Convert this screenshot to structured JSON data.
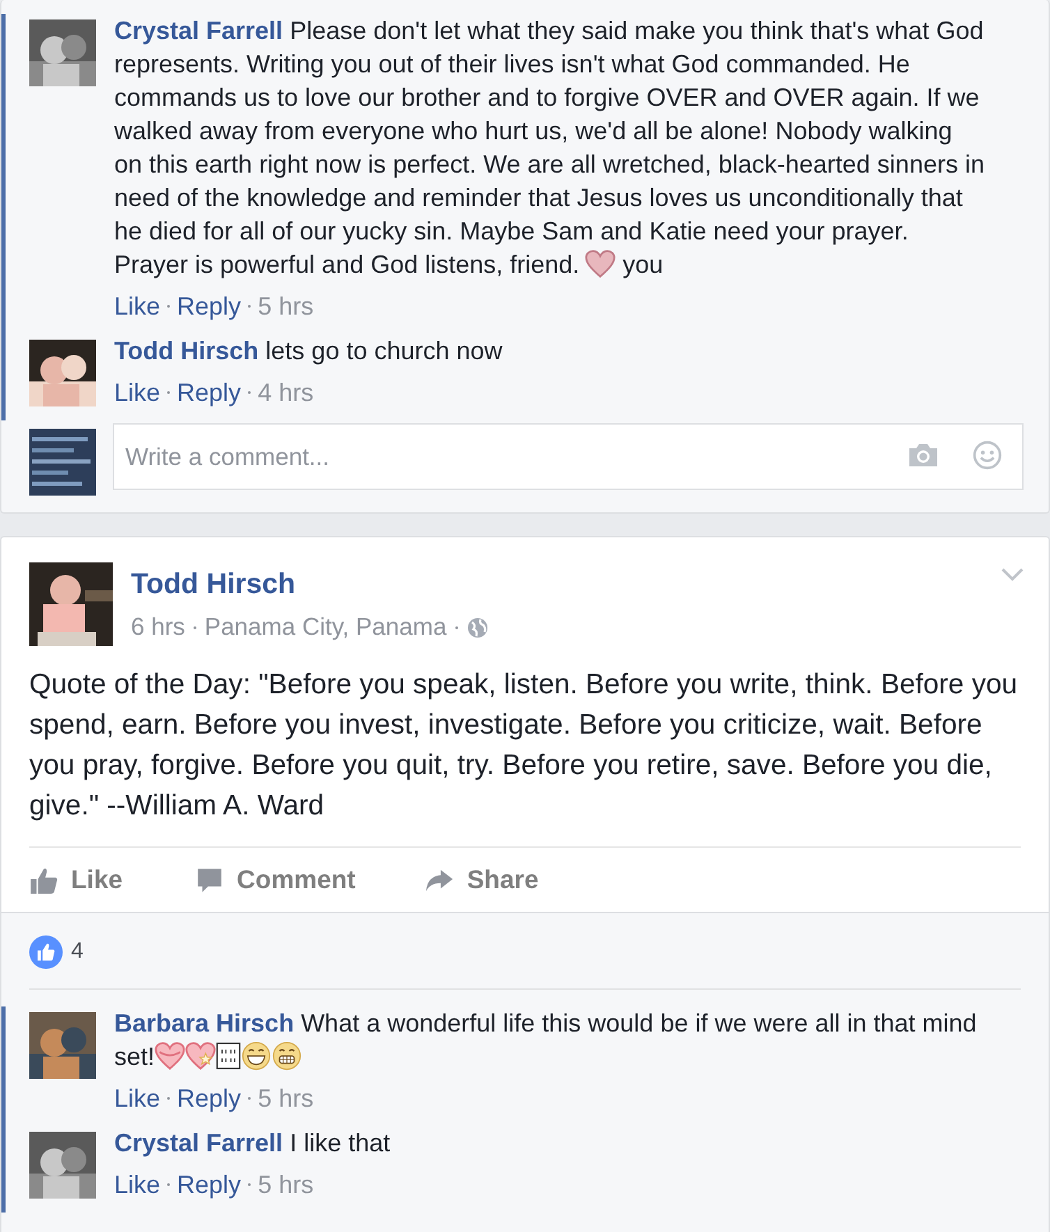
{
  "top_thread": {
    "comments": [
      {
        "author": "Crystal Farrell",
        "parts": [
          {
            "kind": "text",
            "text": "Please don't let what they said make you think that's what God represents. Writing you out of their lives isn't what God commanded. He commands us to love our brother and to forgive OVER and OVER again. If we walked away from everyone who hurt us, we'd all be alone! Nobody walking on this earth right now is perfect. We are all wretched, black-hearted sinners in need of the knowledge and reminder that Jesus loves us unconditionally that he died for all of our yucky sin. Maybe Sam and Katie need your prayer. Prayer is powerful and God listens, friend."
          },
          {
            "kind": "heart"
          },
          {
            "kind": "text",
            "text": "you"
          }
        ],
        "like": "Like",
        "reply": "Reply",
        "time": "5 hrs"
      },
      {
        "author": "Todd Hirsch",
        "parts": [
          {
            "kind": "text",
            "text": "lets go to church now"
          }
        ],
        "like": "Like",
        "reply": "Reply",
        "time": "4 hrs"
      }
    ],
    "composer": {
      "placeholder": "Write a comment..."
    }
  },
  "post": {
    "author": "Todd Hirsch",
    "time": "6 hrs",
    "location": "Panama City, Panama",
    "text": "Quote of the Day: \"Before you speak, listen. Before you write, think. Before you spend, earn. Before you invest, investigate. Before you criticize, wait. Before you pray, forgive. Before you quit, try. Before you retire, save. Before you die, give.\" --William A. Ward",
    "actions": [
      {
        "kind": "like",
        "label": "Like"
      },
      {
        "kind": "comment",
        "label": "Comment"
      },
      {
        "kind": "share",
        "label": "Share"
      }
    ],
    "like_count": "4",
    "comments": [
      {
        "author": "Barbara Hirsch",
        "parts": [
          {
            "kind": "text",
            "text": "What a wonderful life this would be if we were all in that mind set!"
          },
          {
            "kind": "heart-ribbon"
          },
          {
            "kind": "heart-star"
          },
          {
            "kind": "missing-glyph"
          },
          {
            "kind": "grin"
          },
          {
            "kind": "grimace"
          }
        ],
        "like": "Like",
        "reply": "Reply",
        "time": "5 hrs"
      },
      {
        "author": "Crystal Farrell",
        "parts": [
          {
            "kind": "text",
            "text": "I like that"
          }
        ],
        "like": "Like",
        "reply": "Reply",
        "time": "5 hrs"
      }
    ]
  }
}
